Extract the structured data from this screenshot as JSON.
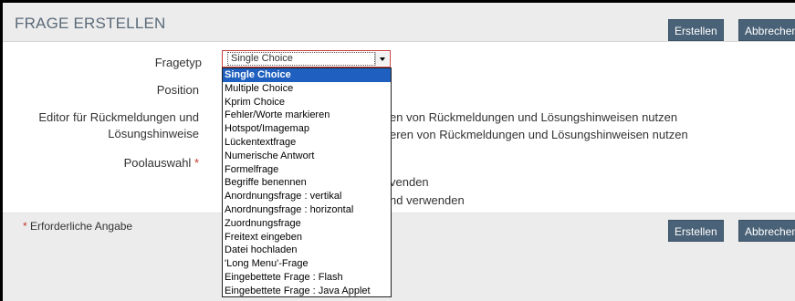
{
  "header": {
    "title": "FRAGE ERSTELLEN",
    "create_label": "Erstellen",
    "cancel_label": "Abbrechen"
  },
  "form": {
    "fragetyp_label": "Fragetyp",
    "position_label": "Position",
    "editor_label_line1": "Editor für Rückmeldungen und",
    "editor_label_line2": "Lösungshinweise",
    "editor_option1_text": "en von Rückmeldungen und Lösungshinweisen nutzen",
    "editor_option2_text": "eren von Rückmeldungen und Lösungshinweisen nutzen",
    "poolauswahl_label": "Poolauswahl",
    "required_marker": "*",
    "pool_option1_text": "venden",
    "pool_option2_text": "nd verwenden"
  },
  "select": {
    "value": "Single Choice",
    "options": [
      "Single Choice",
      "Multiple Choice",
      "Kprim Choice",
      "Fehler/Worte markieren",
      "Hotspot/Imagemap",
      "Lückentextfrage",
      "Numerische Antwort",
      "Formelfrage",
      "Begriffe benennen",
      "Anordnungsfrage : vertikal",
      "Anordnungsfrage : horizontal",
      "Zuordnungsfrage",
      "Freitext eingeben",
      "Datei hochladen",
      "'Long Menu'-Frage",
      "Eingebettete Frage : Flash",
      "Eingebettete Frage : Java Applet"
    ]
  },
  "footer": {
    "required_note": "Erforderliche Angabe",
    "create_label": "Erstellen",
    "cancel_label": "Abbrechen"
  },
  "colors": {
    "button_bg": "#4a6277",
    "selected_option_bg": "#1e5fbf",
    "required": "#c0392b"
  }
}
